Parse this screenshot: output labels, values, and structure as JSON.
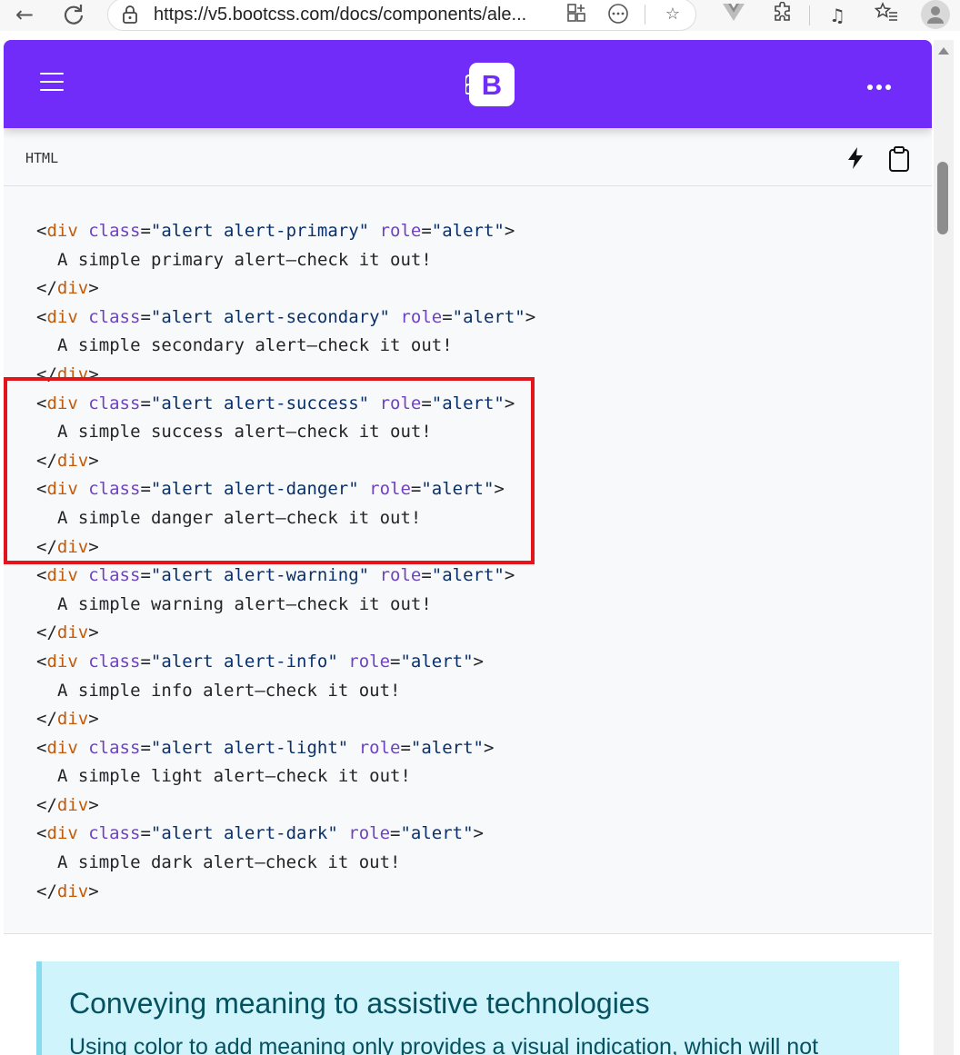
{
  "browser": {
    "url": "https://v5.bootcss.com/docs/components/ale..."
  },
  "navbar": {
    "logo_letter": "B"
  },
  "code_header": {
    "language": "HTML"
  },
  "code_lines": [
    {
      "kind": "open",
      "variant": "primary",
      "cls": "alert alert-primary",
      "role": "alert"
    },
    {
      "kind": "text",
      "text": "A simple primary alert—check it out!"
    },
    {
      "kind": "close"
    },
    {
      "kind": "open",
      "variant": "secondary",
      "cls": "alert alert-secondary",
      "role": "alert"
    },
    {
      "kind": "text",
      "text": "A simple secondary alert—check it out!"
    },
    {
      "kind": "close"
    },
    {
      "kind": "open",
      "variant": "success",
      "cls": "alert alert-success",
      "role": "alert"
    },
    {
      "kind": "text",
      "text": "A simple success alert—check it out!"
    },
    {
      "kind": "close"
    },
    {
      "kind": "open",
      "variant": "danger",
      "cls": "alert alert-danger",
      "role": "alert"
    },
    {
      "kind": "text",
      "text": "A simple danger alert—check it out!"
    },
    {
      "kind": "close"
    },
    {
      "kind": "open",
      "variant": "warning",
      "cls": "alert alert-warning",
      "role": "alert"
    },
    {
      "kind": "text",
      "text": "A simple warning alert—check it out!"
    },
    {
      "kind": "close"
    },
    {
      "kind": "open",
      "variant": "info",
      "cls": "alert alert-info",
      "role": "alert"
    },
    {
      "kind": "text",
      "text": "A simple info alert—check it out!"
    },
    {
      "kind": "close"
    },
    {
      "kind": "open",
      "variant": "light",
      "cls": "alert alert-light",
      "role": "alert"
    },
    {
      "kind": "text",
      "text": "A simple light alert—check it out!"
    },
    {
      "kind": "close"
    },
    {
      "kind": "open",
      "variant": "dark",
      "cls": "alert alert-dark",
      "role": "alert"
    },
    {
      "kind": "text",
      "text": "A simple dark alert—check it out!"
    },
    {
      "kind": "close"
    }
  ],
  "code_tokens": {
    "lt": "<",
    "gt": ">",
    "lt_slash": "</",
    "tag": "div",
    "attr_class": "class",
    "attr_role": "role",
    "eq": "="
  },
  "callout": {
    "title": "Conveying meaning to assistive technologies",
    "text": "Using color to add meaning only provides a visual indication, which will not"
  },
  "colors": {
    "navbar_bg": "#712cf9",
    "highlight_border": "#e3151a",
    "callout_bg": "#cff4fc",
    "callout_text": "#055160"
  }
}
